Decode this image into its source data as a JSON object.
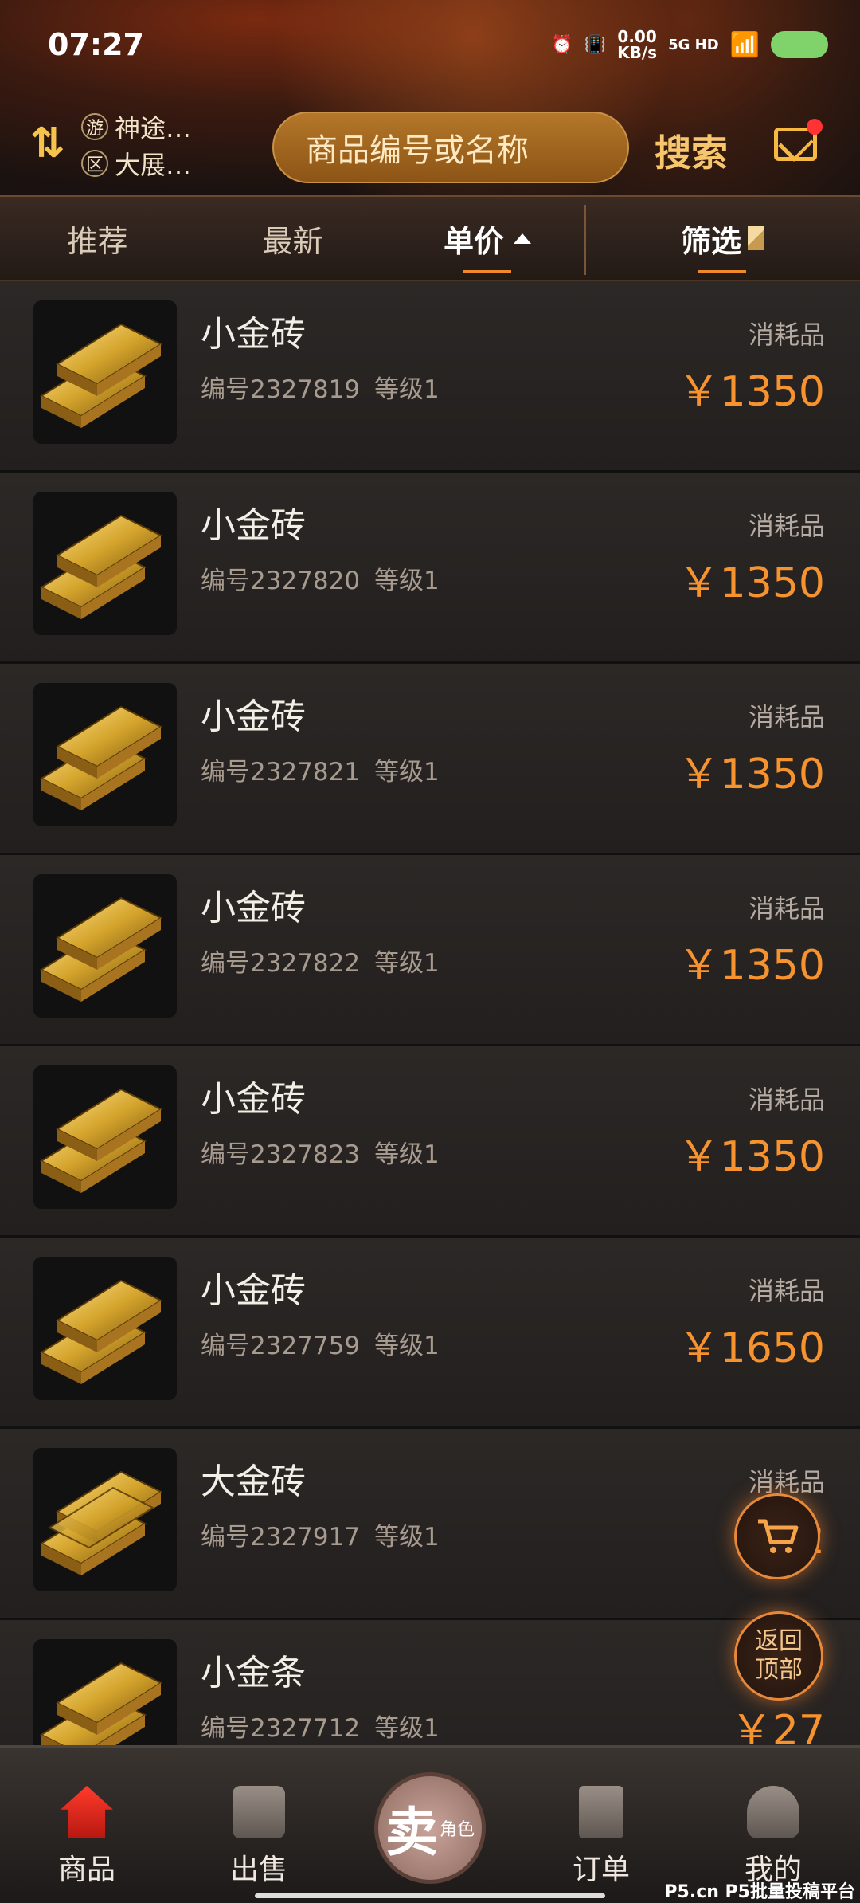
{
  "status": {
    "time": "07:27",
    "speed_value": "0.00",
    "speed_unit": "KB/s",
    "network": "5G HD"
  },
  "header": {
    "server1_badge": "游",
    "server1": "神途…",
    "server2_badge": "区",
    "server2": "大展…",
    "search_placeholder": "商品编号或名称",
    "search_button": "搜索"
  },
  "tabs": {
    "recommend": "推荐",
    "latest": "最新",
    "price": "单价",
    "filter": "筛选"
  },
  "items": [
    {
      "name": "小金砖",
      "id": "编号2327819",
      "level": "等级1",
      "category": "消耗品",
      "price": "￥1350"
    },
    {
      "name": "小金砖",
      "id": "编号2327820",
      "level": "等级1",
      "category": "消耗品",
      "price": "￥1350"
    },
    {
      "name": "小金砖",
      "id": "编号2327821",
      "level": "等级1",
      "category": "消耗品",
      "price": "￥1350"
    },
    {
      "name": "小金砖",
      "id": "编号2327822",
      "level": "等级1",
      "category": "消耗品",
      "price": "￥1350"
    },
    {
      "name": "小金砖",
      "id": "编号2327823",
      "level": "等级1",
      "category": "消耗品",
      "price": "￥1350"
    },
    {
      "name": "小金砖",
      "id": "编号2327759",
      "level": "等级1",
      "category": "消耗品",
      "price": "￥1650"
    },
    {
      "name": "大金砖",
      "id": "编号2327917",
      "level": "等级1",
      "category": "消耗品",
      "price": "￥2"
    },
    {
      "name": "小金条",
      "id": "编号2327712",
      "level": "等级1",
      "category": "",
      "price": "￥27"
    }
  ],
  "floating": {
    "back_top": "返回顶部"
  },
  "nav": {
    "goods": "商品",
    "sell": "出售",
    "center": "卖",
    "center_sub": "角色",
    "orders": "订单",
    "mine": "我的"
  },
  "watermark": "P5.cn P5批量投稿平台"
}
